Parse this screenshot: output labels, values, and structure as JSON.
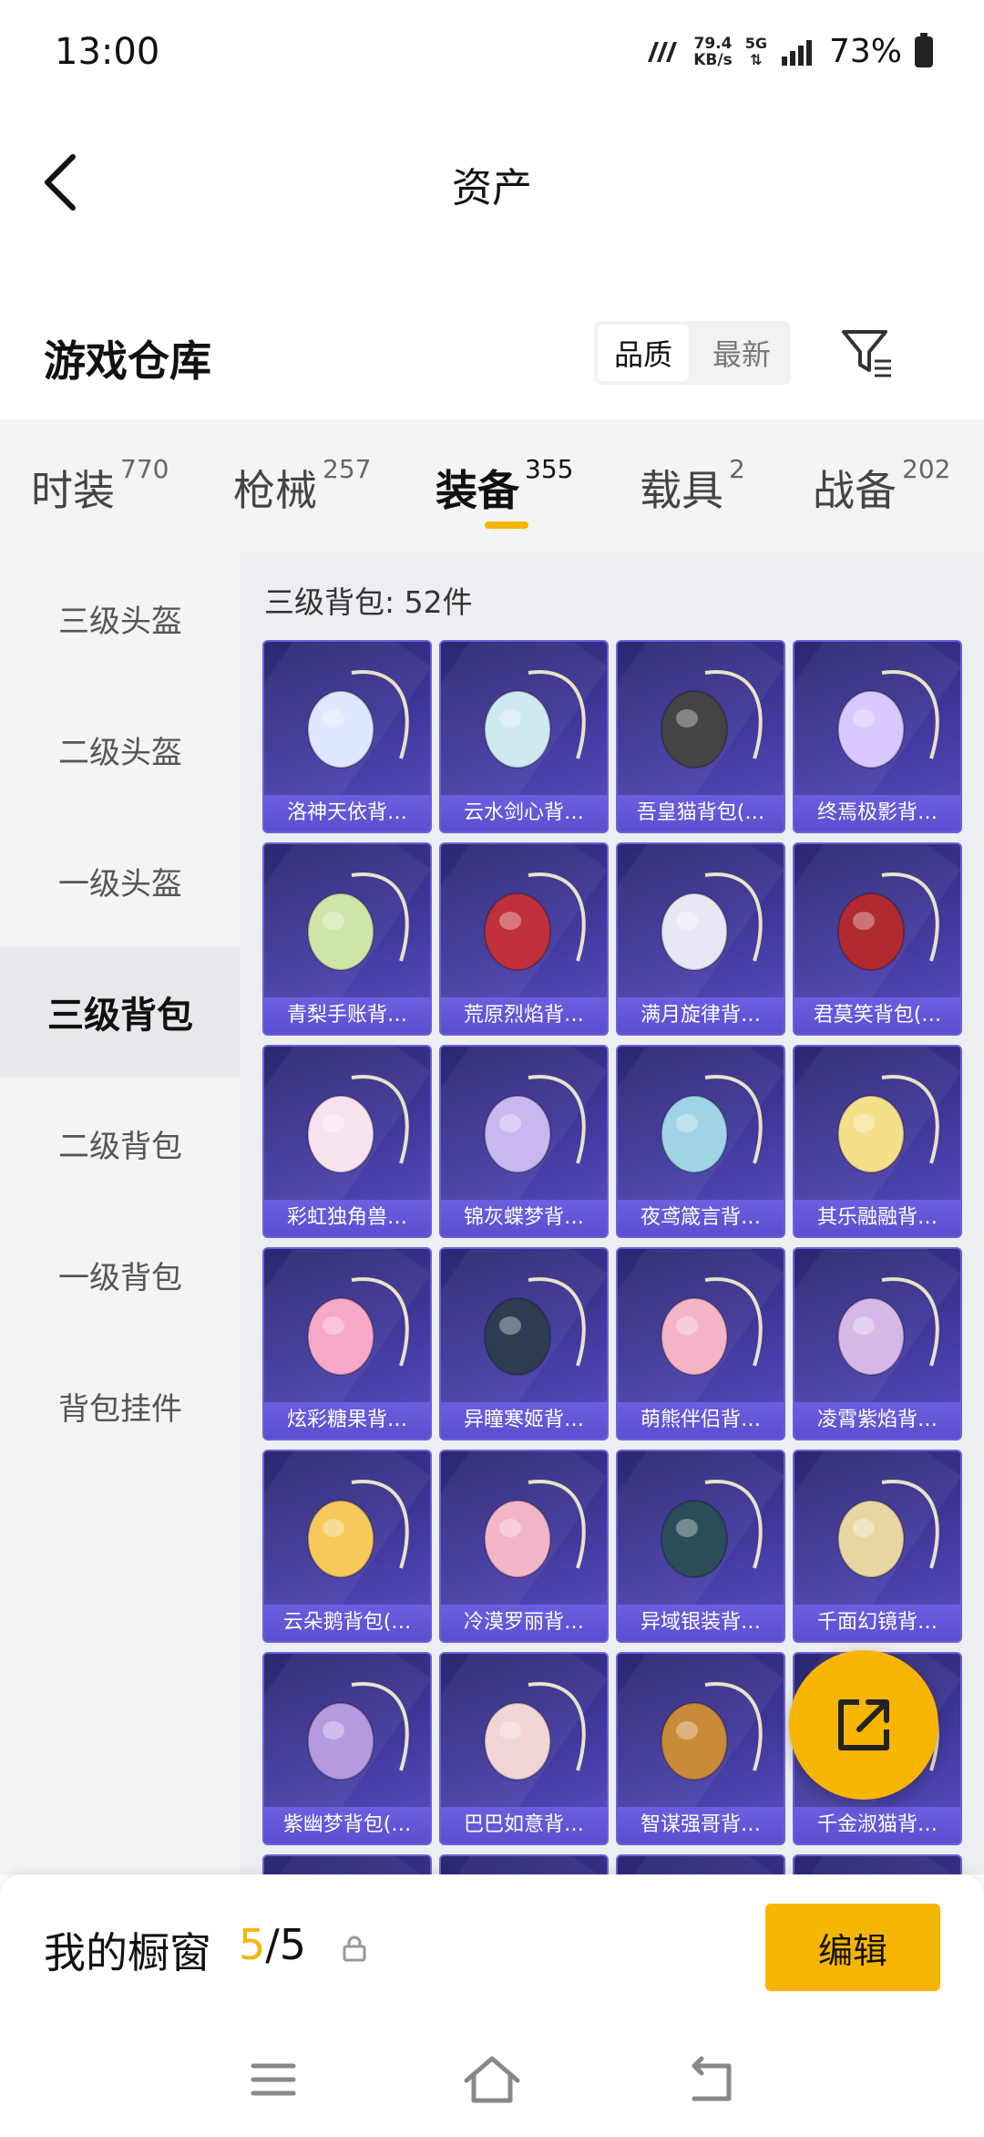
{
  "status_bar": {
    "time": "13:00",
    "net_speed_value": "79.4",
    "net_speed_unit": "KB/s",
    "network_type": "5G",
    "battery_percent": "73%"
  },
  "header": {
    "title": "资产"
  },
  "warehouse": {
    "title": "游戏仓库",
    "sort_options": [
      "品质",
      "最新"
    ],
    "active_sort": "品质"
  },
  "category_tabs": [
    {
      "label": "时装",
      "count": "770"
    },
    {
      "label": "枪械",
      "count": "257"
    },
    {
      "label": "装备",
      "count": "355",
      "active": true
    },
    {
      "label": "载具",
      "count": "2"
    },
    {
      "label": "战备",
      "count": "202"
    }
  ],
  "sidebar": {
    "items": [
      "三级头盔",
      "二级头盔",
      "一级头盔",
      "三级背包",
      "二级背包",
      "一级背包",
      "背包挂件"
    ],
    "active": "三级背包"
  },
  "content": {
    "title": "三级背包: 52件",
    "items": [
      {
        "name": "洛神天依背…"
      },
      {
        "name": "云水剑心背…"
      },
      {
        "name": "吾皇猫背包(…"
      },
      {
        "name": "终焉极影背…"
      },
      {
        "name": "青梨手账背…"
      },
      {
        "name": "荒原烈焰背…"
      },
      {
        "name": "满月旋律背…"
      },
      {
        "name": "君莫笑背包(…"
      },
      {
        "name": "彩虹独角兽…"
      },
      {
        "name": "锦灰蝶梦背…"
      },
      {
        "name": "夜鸢箴言背…"
      },
      {
        "name": "其乐融融背…"
      },
      {
        "name": "炫彩糖果背…"
      },
      {
        "name": "异瞳寒姬背…"
      },
      {
        "name": "萌熊伴侣背…"
      },
      {
        "name": "凌霄紫焰背…"
      },
      {
        "name": "云朵鹅背包(…"
      },
      {
        "name": "冷漠罗丽背…"
      },
      {
        "name": "异域银装背…"
      },
      {
        "name": "千面幻镜背…"
      },
      {
        "name": "紫幽梦背包(…"
      },
      {
        "name": "巴巴如意背…"
      },
      {
        "name": "智谋强哥背…"
      },
      {
        "name": "千金淑猫背…"
      }
    ]
  },
  "showcase": {
    "label": "我的橱窗",
    "current": "5",
    "separator_total": "/5",
    "edit_label": "编辑"
  },
  "colors": {
    "accent": "#f7b500",
    "card_bg": "#3d3596",
    "card_label_bg": "#5b4fd0"
  },
  "icons": {
    "back": "chevron-left-icon",
    "filter": "funnel-filter-icon",
    "share": "external-link-icon",
    "lock": "lock-icon",
    "menu": "menu-icon",
    "home": "home-icon",
    "back_nav": "return-icon"
  }
}
